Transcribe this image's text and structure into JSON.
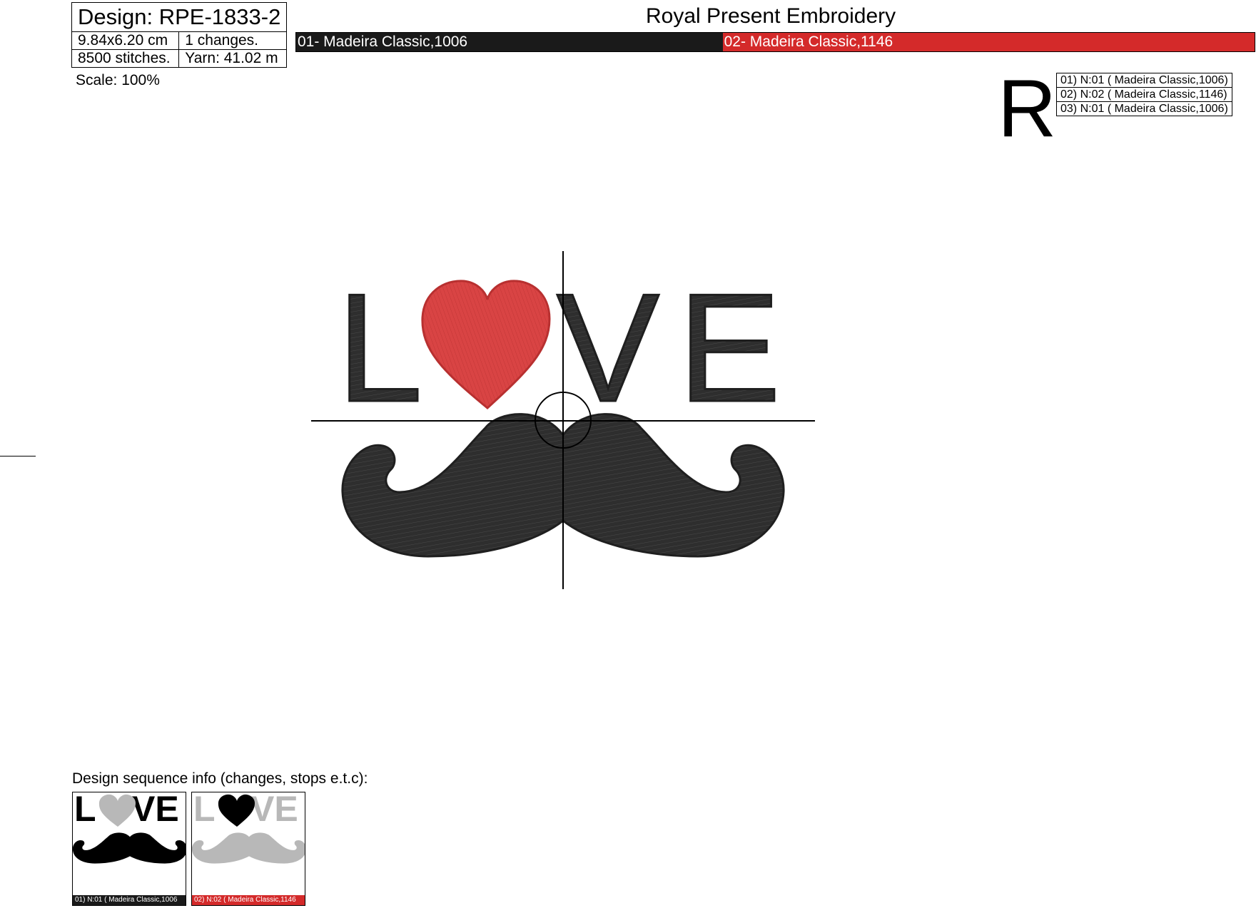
{
  "header": {
    "design_label": "Design: RPE-1833-2",
    "size": "9.84x6.20 cm",
    "changes": "1 changes.",
    "stitches": "8500 stitches.",
    "yarn": "Yarn: 41.02 m",
    "scale": "Scale: 100%",
    "company": "Royal Present Embroidery"
  },
  "thread_bar": [
    {
      "label": "01- Madeira Classic,1006",
      "color": "#1a1a1a",
      "share": 0.445
    },
    {
      "label": "02- Madeira Classic,1146",
      "color": "#d42a2a",
      "share": 0.555
    }
  ],
  "brand_letter": "R",
  "sequence_list": [
    "01) N:01 ( Madeira Classic,1006)",
    "02) N:02 ( Madeira Classic,1146)",
    "03) N:01 ( Madeira Classic,1006)"
  ],
  "design": {
    "letters": [
      "L",
      "V",
      "E"
    ],
    "colors": {
      "dark": "#2e2e2e",
      "heart": "#d94444",
      "stitch_outline": "#1f1f1f"
    }
  },
  "sequence_info": {
    "title": "Design sequence info (changes, stops e.t.c):",
    "thumbnails": [
      {
        "label": "01) N:01 ( Madeira Classic,1006",
        "label_bg": "#1a1a1a",
        "active": "#000000",
        "inactive": "#b8b8b8",
        "active_part": "letters"
      },
      {
        "label": "02) N:02 ( Madeira Classic,1146",
        "label_bg": "#d42a2a",
        "active": "#000000",
        "inactive": "#b8b8b8",
        "active_part": "heart"
      }
    ]
  }
}
